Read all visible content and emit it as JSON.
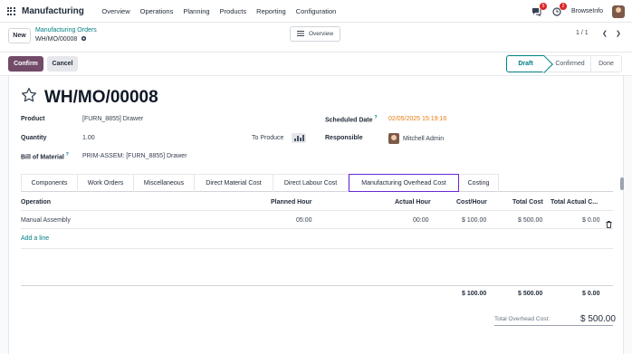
{
  "navbar": {
    "app_name": "Manufacturing",
    "menu": [
      "Overview",
      "Operations",
      "Planning",
      "Products",
      "Reporting",
      "Configuration"
    ],
    "chat_badge": "5",
    "activity_badge": "2",
    "company": "BrowseInfo"
  },
  "control": {
    "new_label": "New",
    "breadcrumb_parent": "Manufacturing Orders",
    "breadcrumb_current": "WH/MO/00008",
    "overview_label": "Overview",
    "pager": "1 / 1"
  },
  "status": {
    "confirm_label": "Confirm",
    "cancel_label": "Cancel",
    "stages": [
      "Draft",
      "Confirmed",
      "Done"
    ],
    "active_stage": "Draft"
  },
  "form": {
    "record_name": "WH/MO/00008",
    "product_label": "Product",
    "product_value": "[FURN_8855] Drawer",
    "quantity_label": "Quantity",
    "quantity_value": "1.00",
    "to_produce_label": "To Produce",
    "bom_label": "Bill of Material",
    "bom_help": "?",
    "bom_value": "PRIM-ASSEM: [FURN_8855] Drawer",
    "scheduled_label": "Scheduled Date",
    "scheduled_help": "?",
    "scheduled_value": "02/05/2025 15:19:16",
    "responsible_label": "Responsible",
    "responsible_value": "Mitchell Admin"
  },
  "tabs": [
    "Components",
    "Work Orders",
    "Miscellaneous",
    "Direct Material Cost",
    "Direct Labour Cost",
    "Manufacturing Overhead Cost",
    "Costing"
  ],
  "active_tab": "Manufacturing Overhead Cost",
  "table": {
    "headers": [
      "Operation",
      "Planned Hour",
      "Actual Hour",
      "Cost/Hour",
      "Total Cost",
      "Total Actual C..."
    ],
    "rows": [
      {
        "operation": "Manual Assembly",
        "planned": "05:00",
        "actual": "00:00",
        "cost_hour": "$ 100.00",
        "total_cost": "$ 500.00",
        "total_actual": "$ 0.00"
      }
    ],
    "add_line": "Add a line",
    "footer": {
      "cost_hour": "$ 100.00",
      "total_cost": "$ 500.00",
      "total_actual": "$ 0.00"
    }
  },
  "summary": {
    "label": "Total Overhead Cost:",
    "value": "$ 500.00"
  },
  "colors": {
    "brand": "#714b67",
    "accent": "#017e84",
    "date": "#e47c12",
    "active_tab_border": "#6d28d9"
  }
}
